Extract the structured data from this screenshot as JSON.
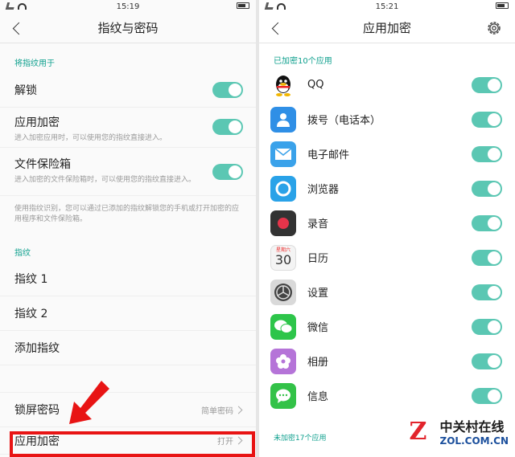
{
  "left": {
    "status_time": "15:19",
    "title": "指纹与密码",
    "section1": "将指纹用于",
    "items": [
      {
        "title": "解锁",
        "desc": ""
      },
      {
        "title": "应用加密",
        "desc": "进入加密应用时，可以使用您的指纹直接进入。"
      },
      {
        "title": "文件保险箱",
        "desc": "进入加密的文件保险箱时，可以使用您的指纹直接进入。"
      }
    ],
    "note": "使用指纹识别，您可以通过已添加的指纹解锁您的手机或打开加密的应用程序和文件保险箱。",
    "section2": "指纹",
    "fingerprints": [
      "指纹 1",
      "指纹 2",
      "添加指纹"
    ],
    "lock_password": {
      "label": "锁屏密码",
      "value": "简单密码"
    },
    "app_encrypt": {
      "label": "应用加密",
      "value": "打开"
    }
  },
  "right": {
    "status_time": "15:21",
    "title": "应用加密",
    "encrypted_header": "已加密10个应用",
    "apps": [
      {
        "name": "QQ",
        "icon": "qq-icon",
        "color": "#ffffff"
      },
      {
        "name": "拨号（电话本）",
        "icon": "contacts-icon",
        "color": "#2f8fe6"
      },
      {
        "name": "电子邮件",
        "icon": "mail-icon",
        "color": "#3aa2ea"
      },
      {
        "name": "浏览器",
        "icon": "browser-icon",
        "color": "#29a2e8"
      },
      {
        "name": "录音",
        "icon": "recorder-icon",
        "color": "#333333"
      },
      {
        "name": "日历",
        "icon": "calendar-icon",
        "color": "#f4f4f4"
      },
      {
        "name": "设置",
        "icon": "settings-icon",
        "color": "#8b8b8b"
      },
      {
        "name": "微信",
        "icon": "wechat-icon",
        "color": "#2dc54a"
      },
      {
        "name": "相册",
        "icon": "gallery-icon",
        "color": "#b574d8"
      },
      {
        "name": "信息",
        "icon": "message-icon",
        "color": "#33c248"
      }
    ],
    "calendar_day": "30",
    "calendar_weekday": "星期六",
    "unencrypted_header": "未加密17个应用"
  },
  "watermark": {
    "cn": "中关村在线",
    "en": "ZOL.COM.CN",
    "letter": "Z"
  },
  "colors": {
    "accent": "#5bc7b3",
    "highlight": "#e81414"
  }
}
